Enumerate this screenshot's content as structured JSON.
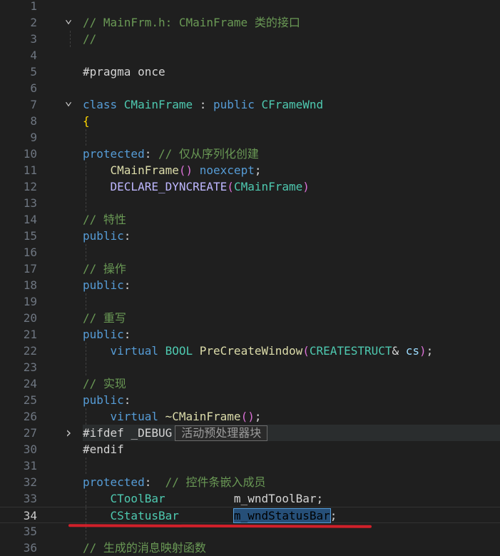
{
  "editor": {
    "lines": [
      {
        "n": "1",
        "fold": "",
        "parts": []
      },
      {
        "n": "2",
        "fold": "v",
        "parts": [
          [
            "cm",
            "// MainFrm.h: CMainFrame 类的接口"
          ]
        ]
      },
      {
        "n": "3",
        "fold": "",
        "parts": [
          [
            "cm",
            "//"
          ]
        ]
      },
      {
        "n": "4",
        "fold": "",
        "parts": []
      },
      {
        "n": "5",
        "fold": "",
        "parts": [
          [
            "pp",
            "#pragma once"
          ]
        ]
      },
      {
        "n": "6",
        "fold": "",
        "parts": []
      },
      {
        "n": "7",
        "fold": "v",
        "parts": [
          [
            "kw",
            "class "
          ],
          [
            "ty",
            "CMainFrame"
          ],
          [
            "id",
            " : "
          ],
          [
            "kw",
            "public "
          ],
          [
            "ty",
            "CFrameWnd"
          ]
        ]
      },
      {
        "n": "8",
        "fold": "",
        "parts": [
          [
            "brace",
            "{"
          ]
        ]
      },
      {
        "n": "9",
        "fold": "",
        "parts": []
      },
      {
        "n": "10",
        "fold": "",
        "parts": [
          [
            "kw",
            "protected"
          ],
          [
            "id",
            ": "
          ],
          [
            "cm",
            "// 仅从序列化创建"
          ]
        ]
      },
      {
        "n": "11",
        "fold": "",
        "parts": [
          [
            "id",
            "    "
          ],
          [
            "fn",
            "CMainFrame"
          ],
          [
            "paren",
            "()"
          ],
          [
            "id",
            " "
          ],
          [
            "kw",
            "noexcept"
          ],
          [
            "id",
            ";"
          ]
        ]
      },
      {
        "n": "12",
        "fold": "",
        "parts": [
          [
            "id",
            "    "
          ],
          [
            "macro",
            "DECLARE_DYNCREATE"
          ],
          [
            "paren",
            "("
          ],
          [
            "ty",
            "CMainFrame"
          ],
          [
            "paren",
            ")"
          ]
        ]
      },
      {
        "n": "13",
        "fold": "",
        "parts": []
      },
      {
        "n": "14",
        "fold": "",
        "parts": [
          [
            "cm",
            "// 特性"
          ]
        ]
      },
      {
        "n": "15",
        "fold": "",
        "parts": [
          [
            "kw",
            "public"
          ],
          [
            "id",
            ":"
          ]
        ]
      },
      {
        "n": "16",
        "fold": "",
        "parts": []
      },
      {
        "n": "17",
        "fold": "",
        "parts": [
          [
            "cm",
            "// 操作"
          ]
        ]
      },
      {
        "n": "18",
        "fold": "",
        "parts": [
          [
            "kw",
            "public"
          ],
          [
            "id",
            ":"
          ]
        ]
      },
      {
        "n": "19",
        "fold": "",
        "parts": []
      },
      {
        "n": "20",
        "fold": "",
        "parts": [
          [
            "cm",
            "// 重写"
          ]
        ]
      },
      {
        "n": "21",
        "fold": "",
        "parts": [
          [
            "kw",
            "public"
          ],
          [
            "id",
            ":"
          ]
        ]
      },
      {
        "n": "22",
        "fold": "",
        "parts": [
          [
            "id",
            "    "
          ],
          [
            "kw",
            "virtual "
          ],
          [
            "ty",
            "BOOL "
          ],
          [
            "fn",
            "PreCreateWindow"
          ],
          [
            "paren",
            "("
          ],
          [
            "ty",
            "CREATESTRUCT"
          ],
          [
            "id",
            "& "
          ],
          [
            "var",
            "cs"
          ],
          [
            "paren",
            ")"
          ],
          [
            "id",
            ";"
          ]
        ]
      },
      {
        "n": "23",
        "fold": "",
        "parts": []
      },
      {
        "n": "24",
        "fold": "",
        "parts": [
          [
            "cm",
            "// 实现"
          ]
        ]
      },
      {
        "n": "25",
        "fold": "",
        "parts": [
          [
            "kw",
            "public"
          ],
          [
            "id",
            ":"
          ]
        ]
      },
      {
        "n": "26",
        "fold": "",
        "parts": [
          [
            "id",
            "    "
          ],
          [
            "kw",
            "virtual "
          ],
          [
            "fn",
            "~CMainFrame"
          ],
          [
            "paren",
            "()"
          ],
          [
            "id",
            ";"
          ]
        ]
      },
      {
        "n": "27",
        "fold": ">",
        "folded": true,
        "parts": [
          [
            "pp",
            "#ifdef "
          ],
          [
            "id",
            "_DEBUG"
          ]
        ],
        "hint": "活动预处理器块"
      },
      {
        "n": "30",
        "fold": "",
        "parts": [
          [
            "pp",
            "#endif"
          ]
        ]
      },
      {
        "n": "31",
        "fold": "",
        "parts": []
      },
      {
        "n": "32",
        "fold": "",
        "parts": [
          [
            "kw",
            "protected"
          ],
          [
            "id",
            ":  "
          ],
          [
            "cm",
            "// 控件条嵌入成员"
          ]
        ]
      },
      {
        "n": "33",
        "fold": "",
        "parts": [
          [
            "id",
            "    "
          ],
          [
            "ty",
            "CToolBar"
          ],
          [
            "id",
            "          "
          ],
          [
            "id",
            "m_wndToolBar"
          ],
          [
            "id",
            ";"
          ]
        ]
      },
      {
        "n": "34",
        "fold": "",
        "current": true,
        "parts": [
          [
            "id",
            "    "
          ],
          [
            "ty",
            "CStatusBar"
          ],
          [
            "id",
            "        "
          ],
          [
            "sel",
            "m_wndStatusBar"
          ],
          [
            "id",
            ";"
          ]
        ]
      },
      {
        "n": "35",
        "fold": "",
        "parts": []
      },
      {
        "n": "36",
        "fold": "",
        "parts": [
          [
            "cm",
            "// 生成的消息映射函数"
          ]
        ]
      }
    ]
  }
}
